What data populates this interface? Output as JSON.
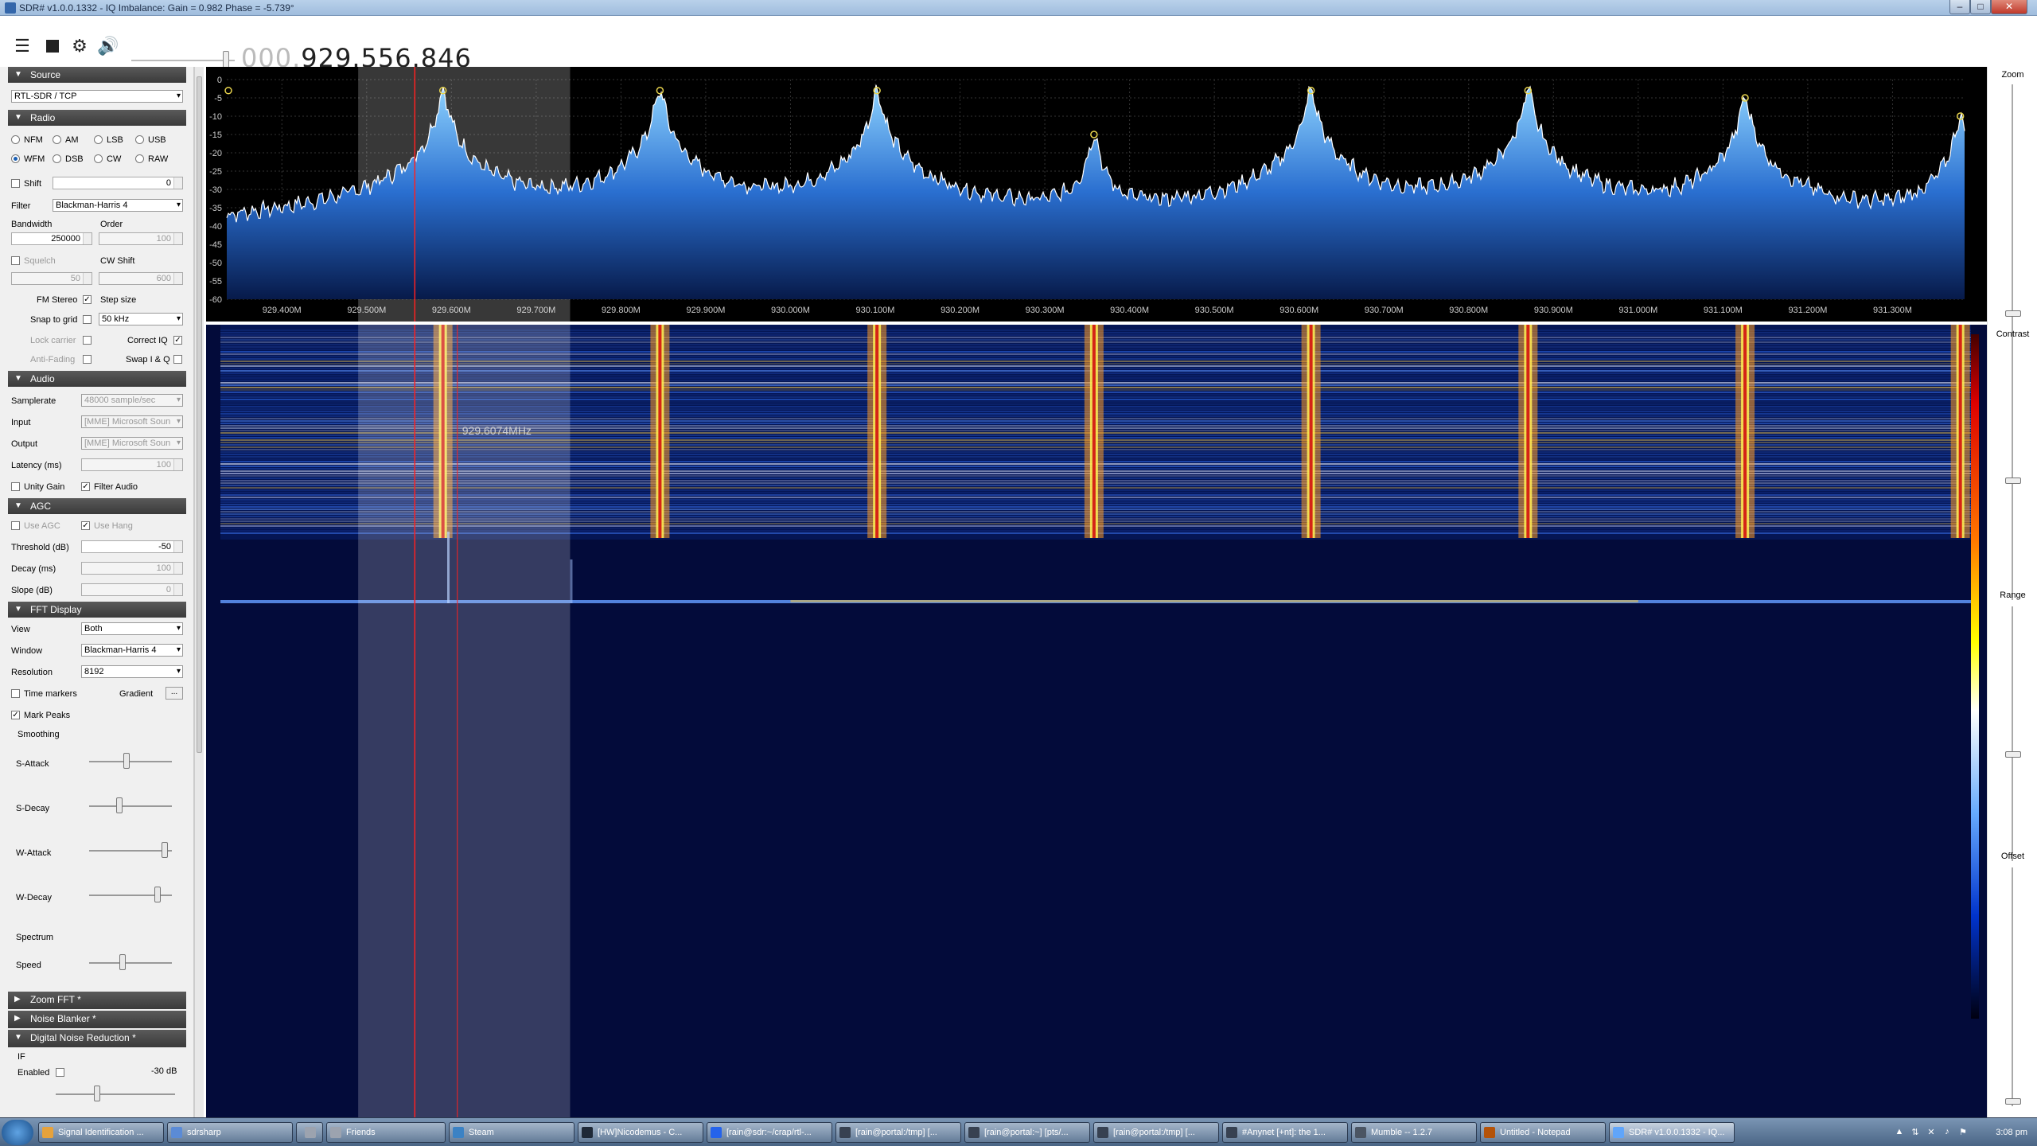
{
  "window": {
    "title": "SDR# v1.0.0.1332 - IQ Imbalance: Gain = 0.982 Phase = -5.739°"
  },
  "toolbar": {
    "menu_icon": "hamburger-icon",
    "stop_icon": "stop-icon",
    "settings_icon": "gear-icon",
    "audio_icon": "speaker-icon",
    "freq_prefix": "000.",
    "freq_value": "929.556.846"
  },
  "source": {
    "header": "Source",
    "device": "RTL-SDR / TCP"
  },
  "radio": {
    "header": "Radio",
    "modes_row1": [
      "NFM",
      "AM",
      "LSB",
      "USB"
    ],
    "modes_row2": [
      "WFM",
      "DSB",
      "CW",
      "RAW"
    ],
    "selected_mode": "WFM",
    "shift_label": "Shift",
    "shift_value": "0",
    "filter_label": "Filter",
    "filter_value": "Blackman-Harris 4",
    "bandwidth_label": "Bandwidth",
    "bandwidth_value": "250000",
    "order_label": "Order",
    "order_value": "100",
    "squelch_label": "Squelch",
    "cw_shift_label": "CW Shift",
    "squelch_value": "50",
    "cw_shift_value": "600",
    "fm_stereo_label": "FM Stereo",
    "step_size_label": "Step size",
    "snap_label": "Snap to grid",
    "step_value": "50 kHz",
    "lock_carrier_label": "Lock carrier",
    "correct_iq_label": "Correct IQ",
    "anti_fading_label": "Anti-Fading",
    "swap_iq_label": "Swap I & Q"
  },
  "audio": {
    "header": "Audio",
    "samplerate_label": "Samplerate",
    "samplerate_value": "48000 sample/sec",
    "input_label": "Input",
    "input_value": "[MME] Microsoft Soun",
    "output_label": "Output",
    "output_value": "[MME] Microsoft Soun",
    "latency_label": "Latency (ms)",
    "latency_value": "100",
    "unity_gain_label": "Unity Gain",
    "filter_audio_label": "Filter Audio"
  },
  "agc": {
    "header": "AGC",
    "use_agc_label": "Use AGC",
    "use_hang_label": "Use Hang",
    "threshold_label": "Threshold (dB)",
    "threshold_value": "-50",
    "decay_label": "Decay (ms)",
    "decay_value": "100",
    "slope_label": "Slope (dB)",
    "slope_value": "0"
  },
  "fft": {
    "header": "FFT Display",
    "view_label": "View",
    "view_value": "Both",
    "window_label": "Window",
    "window_value": "Blackman-Harris 4",
    "resolution_label": "Resolution",
    "resolution_value": "8192",
    "time_markers_label": "Time markers",
    "gradient_label": "Gradient",
    "gradient_button": "...",
    "mark_peaks_label": "Mark Peaks",
    "smoothing_label": "Smoothing",
    "s_attack_label": "S-Attack",
    "s_decay_label": "S-Decay",
    "w_attack_label": "W-Attack",
    "w_decay_label": "W-Decay",
    "spectrum_label": "Spectrum",
    "speed_label": "Speed",
    "s_attack_level": 0.45,
    "s_decay_level": 0.35,
    "w_attack_level": 0.95,
    "w_decay_level": 0.85,
    "speed_level": 0.4
  },
  "collapsed_panels": [
    "Zoom FFT *",
    "Noise Blanker *"
  ],
  "dnr": {
    "header": "Digital Noise Reduction *",
    "if_label": "IF",
    "enabled_label": "Enabled",
    "db_value": "-30 dB"
  },
  "spectrum": {
    "y_ticks": [
      "0",
      "-5",
      "-10",
      "-15",
      "-20",
      "-25",
      "-30",
      "-35",
      "-40",
      "-45",
      "-50",
      "-55",
      "-60"
    ],
    "x_ticks": [
      "929.400M",
      "929.500M",
      "929.600M",
      "929.700M",
      "929.800M",
      "929.900M",
      "930.000M",
      "930.100M",
      "930.200M",
      "930.300M",
      "930.400M",
      "930.500M",
      "930.600M",
      "930.700M",
      "930.800M",
      "930.900M",
      "931.000M",
      "931.100M",
      "931.200M",
      "931.300M"
    ],
    "freq_start_mhz": 929.335,
    "freq_end_mhz": 931.385,
    "peaks_mhz": [
      929.59,
      929.846,
      930.102,
      930.358,
      930.614,
      930.87,
      931.126,
      931.38
    ],
    "peak_levels_db": [
      -3,
      -3,
      -3,
      -15,
      -3,
      -3,
      -5,
      -10
    ],
    "noise_floor_db": -50,
    "filter_center_mhz": 929.615,
    "filter_bandwidth_mhz": 0.25,
    "tuned_mhz": 929.5568,
    "cursor_mhz": 929.607,
    "cursor_label": "929.6074MHz"
  },
  "right_panel": {
    "zoom_label": "Zoom",
    "contrast_label": "Contrast",
    "range_label": "Range",
    "offset_label": "Offset"
  },
  "taskbar": {
    "items": [
      "Signal Identification ...",
      "sdrsharp",
      "Friends",
      "Steam",
      "[HW]Nicodemus - C...",
      "[rain@sdr:~/crap/rtl-...",
      "[rain@portal:/tmp] [...",
      "[rain@portal:~] [pts/...",
      "[rain@portal:/tmp] [...",
      "#Anynet [+nt]: the 1...",
      "Mumble -- 1.2.7",
      "Untitled - Notepad",
      "SDR# v1.0.0.1332 - IQ..."
    ],
    "active_item": "SDR# v1.0.0.1332 - IQ...",
    "clock": "3:08 pm"
  },
  "colors": {
    "spectrum_fill": "#2a6fd0",
    "trace": "#ffffff",
    "tuned_line": "#ff2020",
    "filter_band": "rgba(255,255,255,0.28)",
    "panel_header": "#444444"
  }
}
